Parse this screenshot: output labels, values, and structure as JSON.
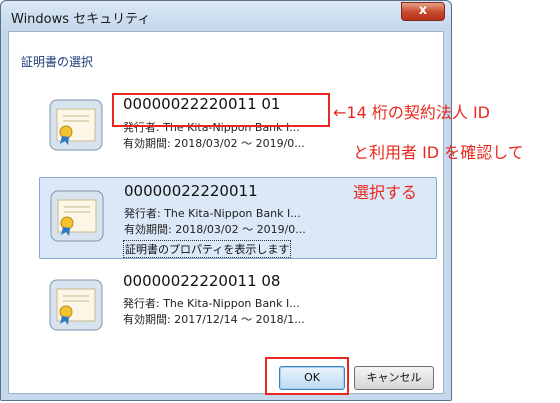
{
  "window": {
    "title": "Windows セキュリティ",
    "close_symbol": "x"
  },
  "dialog": {
    "header": "証明書の選択"
  },
  "certificates": [
    {
      "name": "00000022220011 01",
      "issuer": "発行者: The Kita-Nippon Bank I...",
      "validity": "有効期間: 2018/03/02 ～ 2019/0..."
    },
    {
      "name": "00000022220011",
      "issuer": "発行者: The Kita-Nippon Bank I...",
      "validity": "有効期間: 2018/03/02 ～ 2019/0...",
      "properties_link": "証明書のプロパティを表示します"
    },
    {
      "name": "00000022220011 08",
      "issuer": "発行者: The Kita-Nippon Bank I...",
      "validity": "有効期間: 2017/12/14 ～ 2018/1..."
    }
  ],
  "buttons": {
    "ok": "OK",
    "cancel": "キャンセル"
  },
  "annotations": {
    "line1": "←14 桁の契約法人 ID",
    "line2": "と利用者 ID を確認して",
    "line3": "選択する"
  },
  "colors": {
    "annotation_red": "#e8281e",
    "selection_bg": "#dbe8f7"
  }
}
